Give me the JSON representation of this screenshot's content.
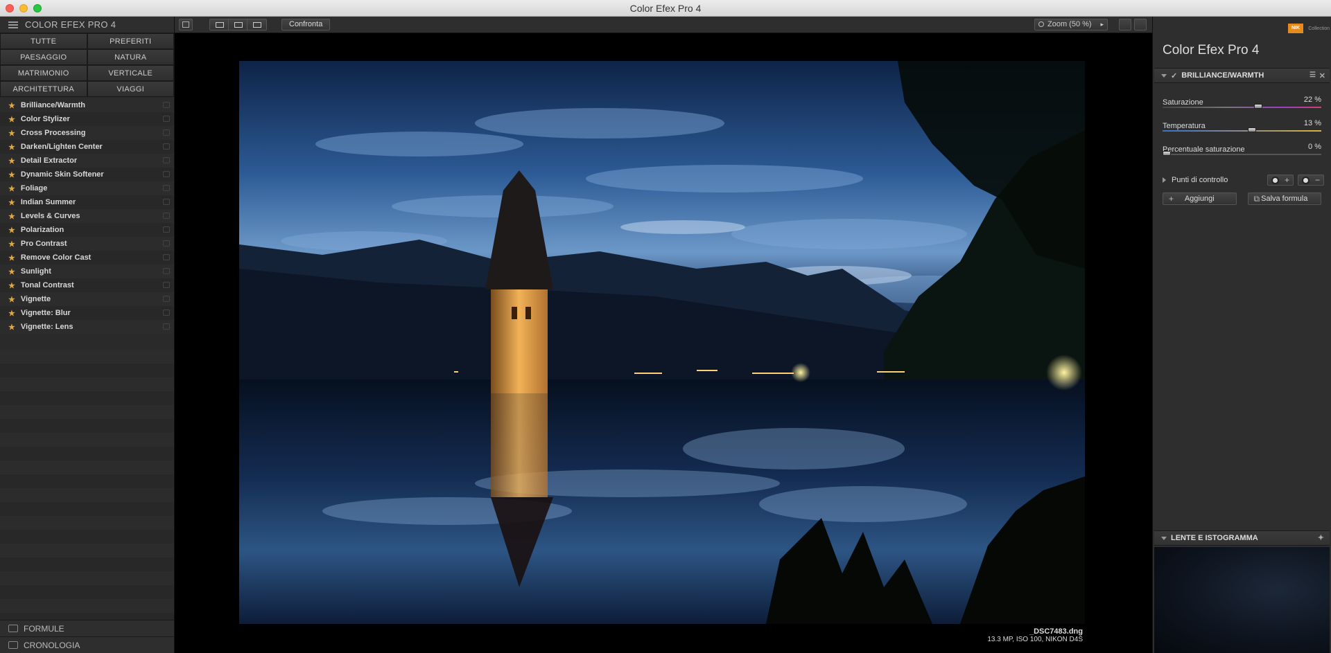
{
  "window": {
    "title": "Color Efex Pro 4"
  },
  "sidebar": {
    "header": "COLOR EFEX PRO 4",
    "categories": [
      "TUTTE",
      "PREFERITI",
      "PAESAGGIO",
      "NATURA",
      "MATRIMONIO",
      "VERTICALE",
      "ARCHITETTURA",
      "VIAGGI"
    ],
    "filters": [
      "Brilliance/Warmth",
      "Color Stylizer",
      "Cross Processing",
      "Darken/Lighten Center",
      "Detail Extractor",
      "Dynamic Skin Softener",
      "Foliage",
      "Indian Summer",
      "Levels & Curves",
      "Polarization",
      "Pro Contrast",
      "Remove Color Cast",
      "Sunlight",
      "Tonal Contrast",
      "Vignette",
      "Vignette: Blur",
      "Vignette: Lens"
    ],
    "bottom": {
      "formule": "FORMULE",
      "cronologia": "CRONOLOGIA"
    }
  },
  "toolbar": {
    "confronta": "Confronta",
    "zoom": "Zoom (50 %)"
  },
  "image": {
    "filename": "_DSC7483.dng",
    "info": "13.3 MP, ISO 100, NIKON D4S"
  },
  "panel": {
    "brand": "Color Efex Pro",
    "brand_version": "4",
    "logo_text": "NIK",
    "logo_sub": "Collection",
    "filter_title": "BRILLIANCE/WARMTH",
    "params": [
      {
        "label": "Saturazione",
        "value": "22 %",
        "level": 0.61
      },
      {
        "label": "Temperatura",
        "value": "13 %",
        "level": 0.565
      },
      {
        "label": "Percentuale saturazione",
        "value": "0 %",
        "level": 0.0
      }
    ],
    "control_points": "Punti di controllo",
    "add": "Aggiungi",
    "save": "Salva formula",
    "lens_section": "LENTE E ISTOGRAMMA"
  },
  "colors": {
    "accent_star": "#e3a73b",
    "background": "#2a2a2a"
  }
}
